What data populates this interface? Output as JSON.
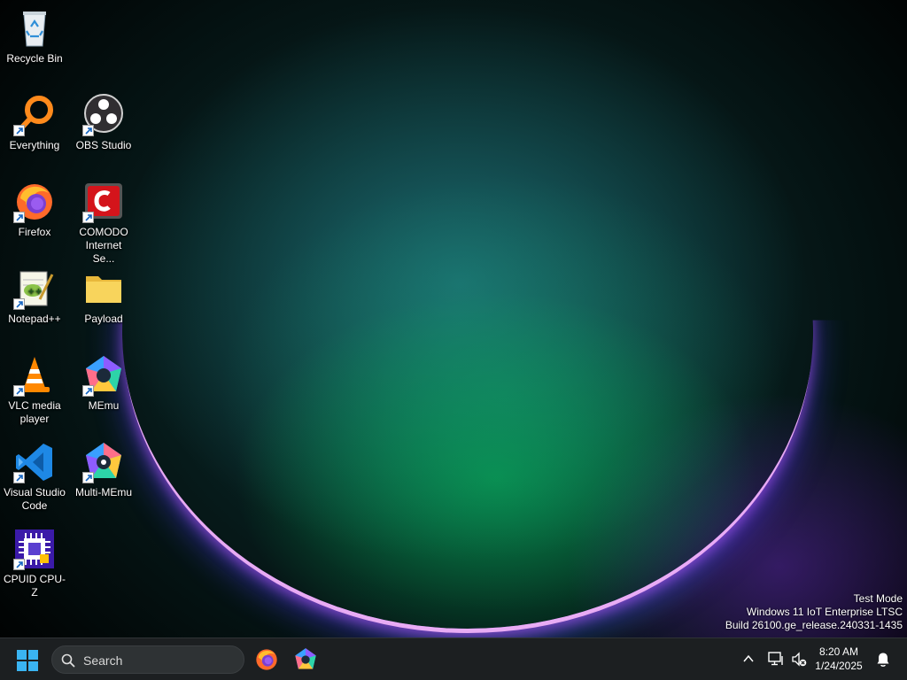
{
  "desktop": {
    "icons": [
      {
        "label": "Recycle Bin",
        "icon": "recycle-bin-icon"
      },
      {
        "label": "Everything",
        "icon": "everything-search-icon"
      },
      {
        "label": "OBS Studio",
        "icon": "obs-studio-icon"
      },
      {
        "label": "Firefox",
        "icon": "firefox-icon"
      },
      {
        "label": "COMODO Internet Se...",
        "icon": "comodo-icon"
      },
      {
        "label": "Notepad++",
        "icon": "notepad-plus-plus-icon"
      },
      {
        "label": "Payload",
        "icon": "folder-icon"
      },
      {
        "label": "VLC media player",
        "icon": "vlc-icon"
      },
      {
        "label": "MEmu",
        "icon": "memu-icon"
      },
      {
        "label": "Visual Studio Code",
        "icon": "vscode-icon"
      },
      {
        "label": "Multi-MEmu",
        "icon": "multi-memu-icon"
      },
      {
        "label": "CPUID CPU-Z",
        "icon": "cpu-z-icon"
      }
    ]
  },
  "watermark": {
    "line1": "Test Mode",
    "line2": "Windows 11 IoT Enterprise LTSC",
    "line3": "Build 26100.ge_release.240331-1435"
  },
  "taskbar": {
    "search_placeholder": "Search",
    "pinned": [
      "firefox-icon",
      "memu-icon"
    ],
    "tray_icons": [
      "chevron-up-icon",
      "network-icon",
      "volume-muted-icon",
      "bell-icon"
    ],
    "time": "8:20 AM",
    "date": "1/24/2025"
  }
}
